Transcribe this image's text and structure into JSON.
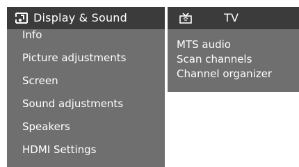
{
  "left_panel": {
    "title": "Display & Sound",
    "icon": "display-sound-icon",
    "items": [
      {
        "label": "Info"
      },
      {
        "label": "Picture adjustments"
      },
      {
        "label": "Screen"
      },
      {
        "label": "Sound adjustments"
      },
      {
        "label": "Speakers"
      },
      {
        "label": "HDMI Settings"
      }
    ]
  },
  "right_panel": {
    "title": "TV",
    "icon": "tv-icon",
    "items": [
      {
        "label": "MTS audio"
      },
      {
        "label": "Scan channels"
      },
      {
        "label": "Channel organizer"
      }
    ]
  },
  "colors": {
    "panel_bg": "#6f6f6f",
    "header_bg": "#3b3b3b",
    "text": "#ffffff"
  }
}
